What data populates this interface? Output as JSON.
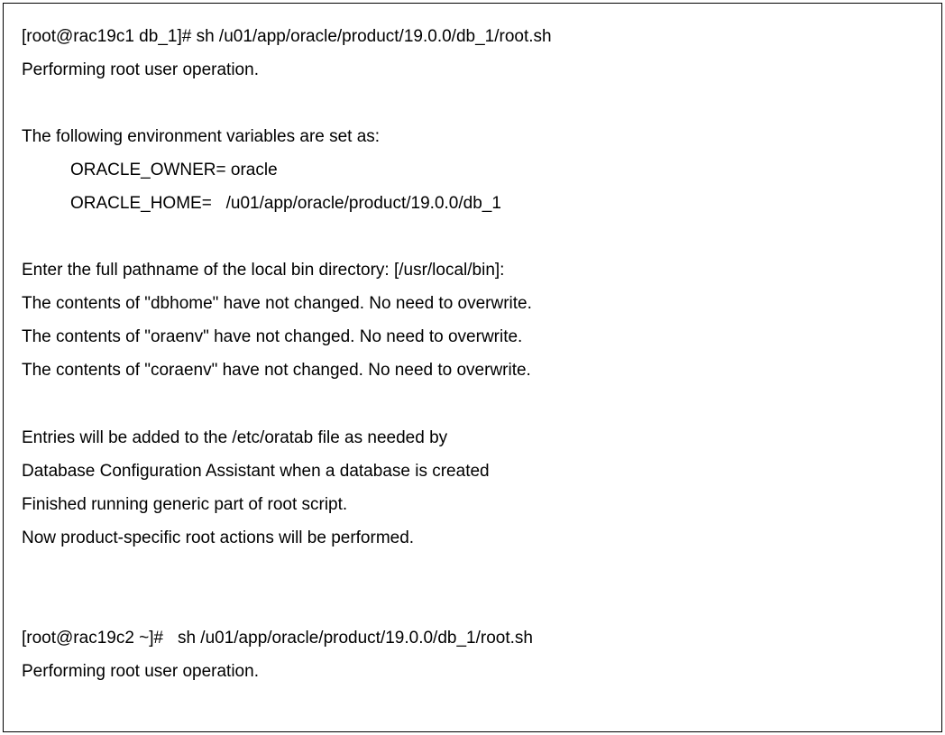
{
  "terminal": {
    "lines": {
      "l1": "[root@rac19c1 db_1]# sh /u01/app/oracle/product/19.0.0/db_1/root.sh",
      "l2": "Performing root user operation.",
      "l3": "The following environment variables are set as:",
      "l4": "ORACLE_OWNER= oracle",
      "l5": "ORACLE_HOME=   /u01/app/oracle/product/19.0.0/db_1",
      "l6": "Enter the full pathname of the local bin directory: [/usr/local/bin]:",
      "l7": "The contents of \"dbhome\" have not changed. No need to overwrite.",
      "l8": "The contents of \"oraenv\" have not changed. No need to overwrite.",
      "l9": "The contents of \"coraenv\" have not changed. No need to overwrite.",
      "l10": "Entries will be added to the /etc/oratab file as needed by",
      "l11": "Database Configuration Assistant when a database is created",
      "l12": "Finished running generic part of root script.",
      "l13": "Now product-specific root actions will be performed.",
      "l14": "[root@rac19c2 ~]#   sh /u01/app/oracle/product/19.0.0/db_1/root.sh",
      "l15": "Performing root user operation."
    }
  }
}
